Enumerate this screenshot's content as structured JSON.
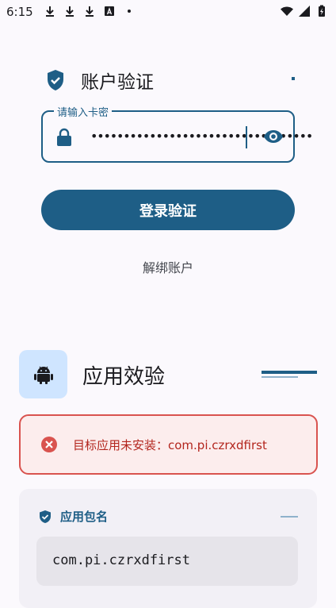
{
  "status_bar": {
    "time": "6:15",
    "left_icons": [
      "download-icon",
      "download-icon",
      "download-icon",
      "app-a-icon",
      "dot-icon"
    ],
    "right_icons": [
      "wifi-icon",
      "signal-icon",
      "battery-charging-icon"
    ]
  },
  "account": {
    "title": "账户验证",
    "shield_icon": "shield-check-icon",
    "card_field": {
      "label": "请输入卡密",
      "value_masked": "••••••••••••••••••••••••••••••••••"
    },
    "login_button": "登录验证",
    "unbind_link": "解绑账户"
  },
  "app_check": {
    "title": "应用效验",
    "tile_icon": "android-icon",
    "error": {
      "icon": "error-circle-icon",
      "text": "目标应用未安装：com.pi.czrxdfirst"
    },
    "package_card": {
      "label": "应用包名",
      "value": "com.pi.czrxdfirst"
    }
  },
  "colors": {
    "primary": "#1E5E86",
    "background": "#FBF9FD",
    "error": "#D9534F",
    "error_bg": "#FCEDED",
    "tile_bg": "#CFE5FF"
  }
}
